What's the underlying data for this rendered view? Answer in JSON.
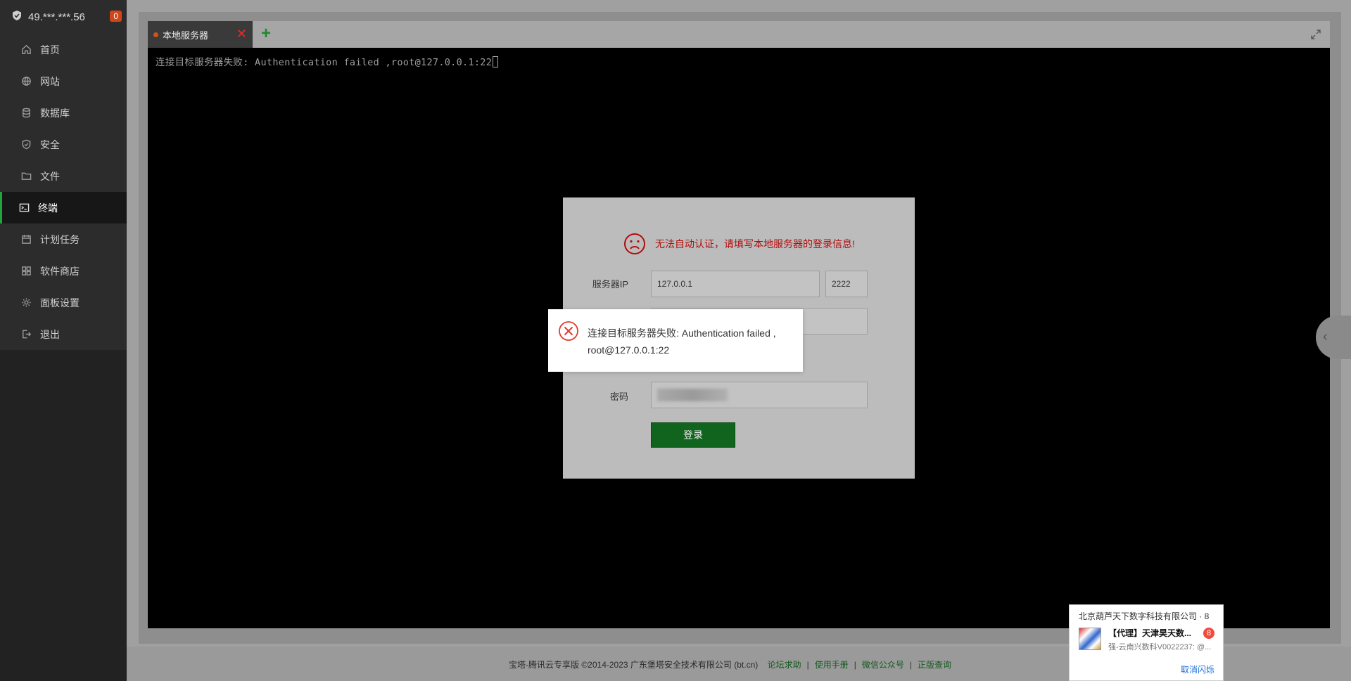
{
  "sidebar": {
    "server_ip": "49.***.***.56",
    "badge_count": "0",
    "items": [
      {
        "label": "首页",
        "icon": "home-icon"
      },
      {
        "label": "网站",
        "icon": "globe-icon"
      },
      {
        "label": "数据库",
        "icon": "database-icon"
      },
      {
        "label": "安全",
        "icon": "shield-icon"
      },
      {
        "label": "文件",
        "icon": "folder-icon"
      },
      {
        "label": "终端",
        "icon": "terminal-icon",
        "active": true
      },
      {
        "label": "计划任务",
        "icon": "calendar-icon"
      },
      {
        "label": "软件商店",
        "icon": "apps-icon"
      },
      {
        "label": "面板设置",
        "icon": "gear-icon"
      },
      {
        "label": "退出",
        "icon": "logout-icon"
      }
    ]
  },
  "tabs": [
    {
      "label": "本地服务器",
      "active": true
    }
  ],
  "terminal": {
    "line": "连接目标服务器失败: Authentication failed ,root@127.0.0.1:22"
  },
  "login": {
    "warning": "无法自动认证，请填写本地服务器的登录信息!",
    "ip_label": "服务器IP",
    "ip_value": "127.0.0.1",
    "port_value": "2222",
    "password_label": "密码",
    "submit_label": "登录"
  },
  "toast": {
    "line1": "连接目标服务器失败: Authentication failed ,",
    "line2": "root@127.0.0.1:22"
  },
  "footer": {
    "copyright": "宝塔-腾讯云专享版 ©2014-2023 广东堡塔安全技术有限公司 (bt.cn)",
    "links": [
      "论坛求助",
      "使用手册",
      "微信公众号",
      "正版查询"
    ]
  },
  "notification": {
    "title": "北京葫芦天下数字科技有限公司 · 8",
    "name": "【代理】天津昊天数...",
    "count": "8",
    "message": "强-云南兴数科V0022237: @...",
    "cancel": "取消闪烁"
  },
  "colors": {
    "accent": "#20a53a",
    "error": "#b30d0d",
    "badge": "#d0461b"
  }
}
